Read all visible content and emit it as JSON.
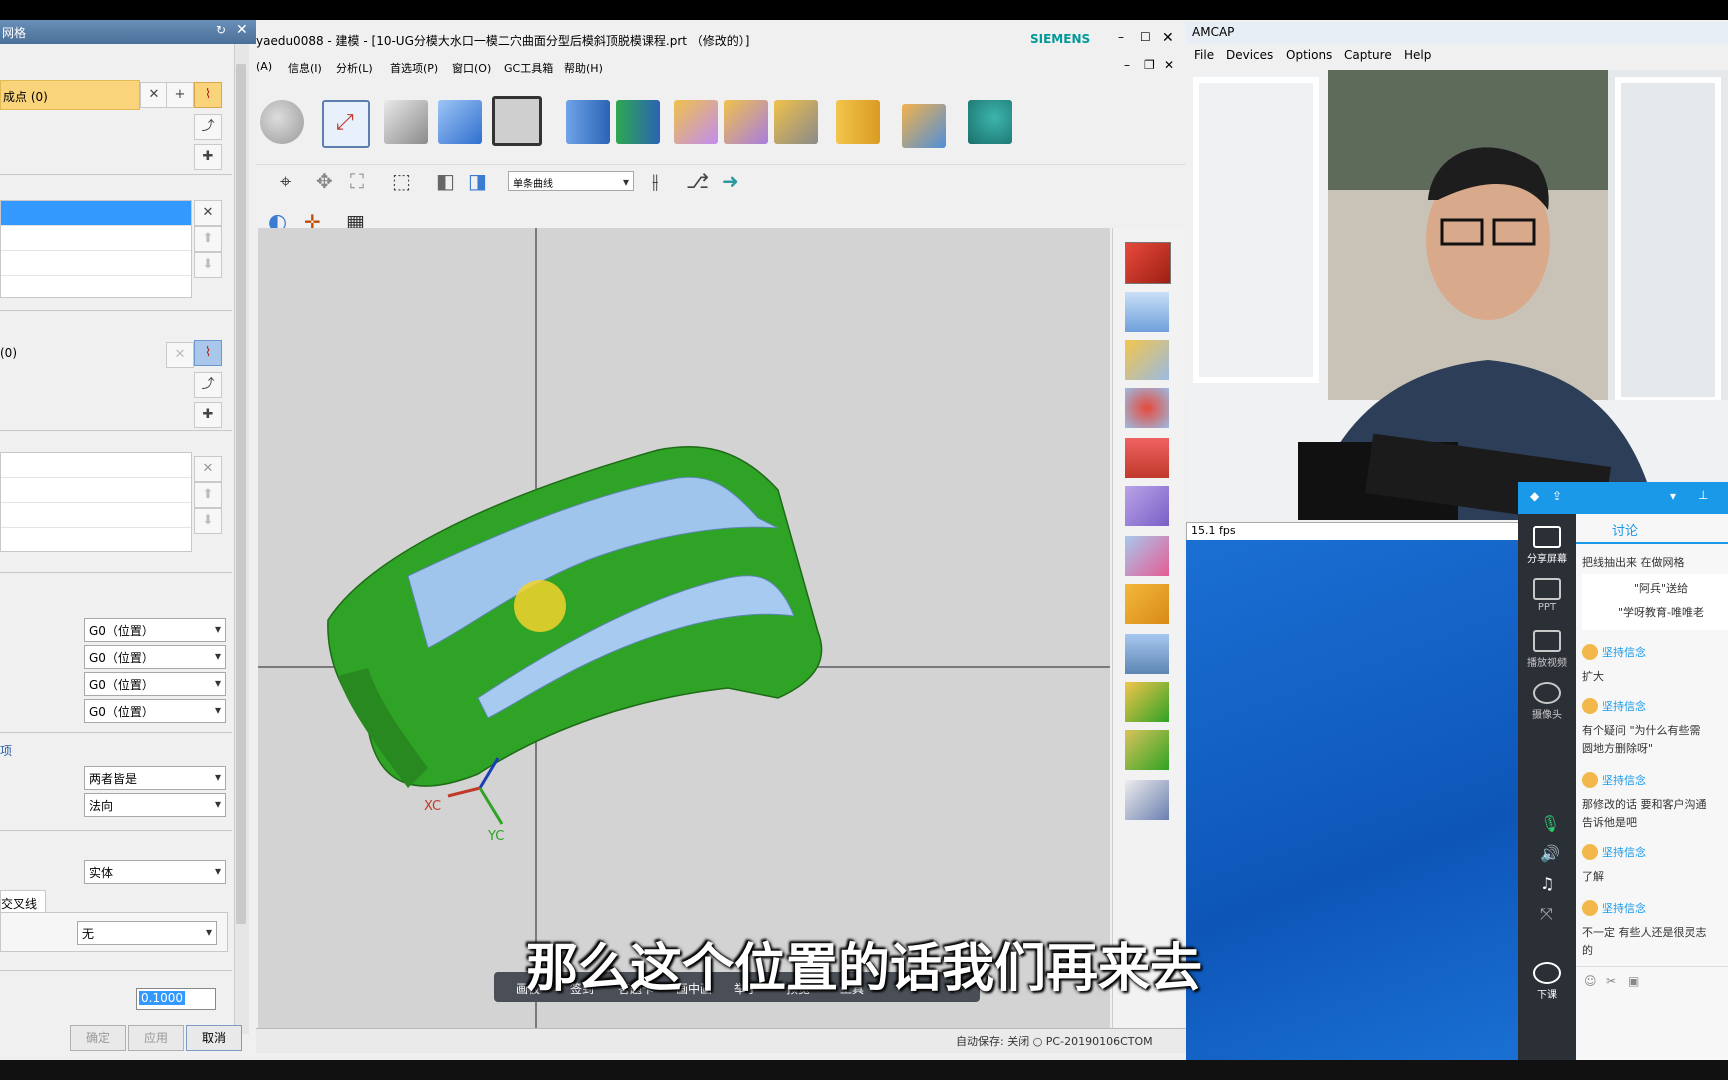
{
  "dialog": {
    "title": "网格",
    "sel_label": "成点 (0)",
    "sel2_label": "(0)",
    "dropdowns": [
      "G0（位置）",
      "G0（位置）",
      "G0（位置）",
      "G0（位置）"
    ],
    "opt_section": "项",
    "dd_both": "两者皆是",
    "dd_normal": "法向",
    "dd_solid": "实体",
    "cross_tab": "交叉线串",
    "dd_none": "无",
    "tolerance": "0.1000",
    "btn_ok": "确定",
    "btn_apply": "应用",
    "btn_cancel": "取消"
  },
  "nx": {
    "title": "yaedu0088 - 建模 - [10-UG分模大水口一模二穴曲面分型后模斜顶脱模课程.prt （修改的）]",
    "brand": "SIEMENS",
    "menus": [
      "(A)",
      "信息(I)",
      "分析(L)",
      "首选项(P)",
      "窗口(O)",
      "GC工具箱",
      "帮助(H)"
    ],
    "curve_filter": "单条曲线",
    "status_text": "自动保存: 关闭   ○ PC-20190106CTOM",
    "axis_xc": "XC",
    "axis_yc": "YC"
  },
  "amcap": {
    "title": "AMCAP",
    "menus": [
      "File",
      "Devices",
      "Options",
      "Capture",
      "Help"
    ],
    "fps": "15.1 fps"
  },
  "chat": {
    "tab": "讨论",
    "side": [
      "分享屏幕",
      "PPT",
      "播放视频",
      "摄像头",
      "下课"
    ],
    "messages": [
      {
        "text": "把线抽出来  在做网格"
      },
      {
        "text": "\"阿兵\"送给"
      },
      {
        "text": "\"学呀教育-唯唯老"
      },
      {
        "user": "坚持信念",
        "text": "扩大"
      },
      {
        "user": "坚持信念",
        "text": "有个疑问  \"为什么有些需"
      },
      {
        "text": "圆地方删除呀\""
      },
      {
        "user": "坚持信念",
        "text": "那修改的话  要和客户沟通"
      },
      {
        "text": "告诉他是吧"
      },
      {
        "user": "坚持信念",
        "text": "了解"
      },
      {
        "user": "坚持信念",
        "text": "不一定  有些人还是很灵志"
      },
      {
        "text": "的"
      }
    ]
  },
  "floatbar": [
    "画板",
    "签到",
    "答题卡",
    "画中画",
    "举手",
    "预览",
    "工具"
  ],
  "subtitle": "那么这个位置的话我们再来去"
}
